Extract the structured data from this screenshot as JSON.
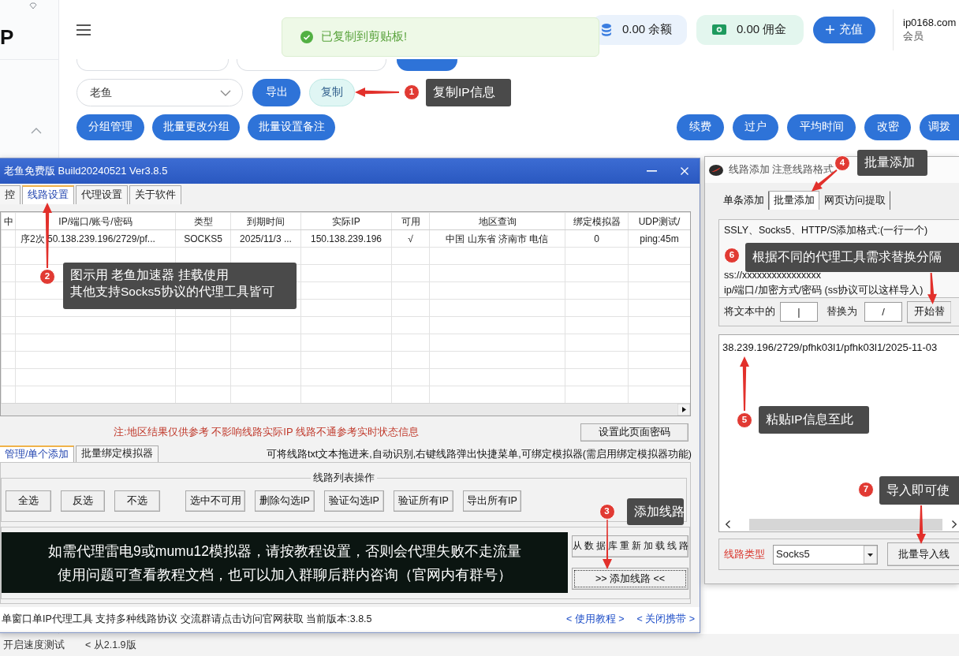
{
  "sidebar": {
    "logo": "P"
  },
  "header": {
    "toast": "已复制到剪贴板!",
    "balance": "0.00 余额",
    "commission": "0.00 佣金",
    "recharge_button": "充值",
    "account": {
      "name": "ip0168.com",
      "role": "会员"
    }
  },
  "filters": {
    "group_select": "老鱼",
    "export_button": "导出",
    "copy_button": "复制"
  },
  "actions_left": [
    "分组管理",
    "批量更改分组",
    "批量设置备注"
  ],
  "actions_right": [
    "续费",
    "过户",
    "平均时间",
    "改密",
    "调拨"
  ],
  "app_window": {
    "title": "老鱼免费版 Build20240521 Ver3.8.5",
    "tabs": [
      {
        "label": "控",
        "selected": false
      },
      {
        "label": "线路设置",
        "selected": true
      },
      {
        "label": "代理设置",
        "selected": false
      },
      {
        "label": "关于软件",
        "selected": false
      }
    ],
    "table": {
      "columns": [
        "中",
        "IP/端口/账号/密码",
        "类型",
        "到期时间",
        "实际IP",
        "可用",
        "地区查询",
        "绑定模拟器",
        "UDP测试/"
      ],
      "rows": [
        [
          "",
          "序2次 50.138.239.196/2729/pf...",
          "SOCKS5",
          "2025/11/3 ...",
          "150.138.239.196",
          "√",
          "中国 山东省 济南市 电信",
          "0",
          "ping:45m"
        ]
      ]
    },
    "note": "注:地区结果仅供参考 不影响线路实际IP 线路不通参考实时状态信息",
    "password_button": "设置此页面密码",
    "lower_tabs": [
      {
        "label": "管理/单个添加",
        "selected": true
      },
      {
        "label": "批量绑定模拟器",
        "selected": false
      }
    ],
    "hint": "可将线路txt文本拖进来,自动识别,右键线路弹出快捷菜单,可绑定模拟器(需启用绑定模拟器功能)",
    "list_actions": {
      "title": "线路列表操作",
      "buttons": [
        "全选",
        "反选",
        "不选",
        "选中不可用",
        "删除勾选IP",
        "验证勾选IP",
        "验证所有IP",
        "导出所有IP"
      ]
    },
    "banner": [
      "如需代理雷电9或mumu12模拟器，请按教程设置，否则会代理失败不走流量",
      "使用问题可查看教程文档，也可以加入群聊后群内咨询（官网内有群号）"
    ],
    "reload_button": "从数据库重新加载线路",
    "add_button": ">>  添加线路  <<",
    "status_bar": {
      "text": "单窗口单IP代理工具 支持多种线路协议 交流群请点击访问官网获取 当前版本:3.8.5",
      "links": [
        "< 使用教程 >",
        "< 关闭携带 >"
      ]
    }
  },
  "add_window": {
    "title": "线路添加 注意线路格式",
    "tabs": [
      {
        "label": "单条添加",
        "selected": false
      },
      {
        "label": "批量添加",
        "selected": true
      },
      {
        "label": "网页访问提取",
        "selected": false
      }
    ],
    "format_lines": [
      "SSLY、Socks5、HTTP/S添加格式:(一行一个)",
      "ss://xxxxxxxxxxxxxxxx",
      "ip/端口/加密方式/密码 (ss协议可以这样导入)"
    ],
    "replace": {
      "find_label": "将文本中的",
      "find_value": "|",
      "replace_label": "替换为",
      "replace_value": "/",
      "button": "开始替"
    },
    "paste_text": "38.239.196/2729/pfhk03l1/pfhk03l1/2025-11-03",
    "type_label": "线路类型",
    "type_select": "Socks5",
    "import_button": "批量导入线"
  },
  "callouts": [
    {
      "number": "1",
      "lines": [
        "复制IP信息"
      ]
    },
    {
      "number": "2",
      "lines": [
        "图示用 老鱼加速器 挂载使用",
        "其他支持Socks5协议的代理工具皆可"
      ]
    },
    {
      "number": "3",
      "lines": [
        "添加线路"
      ]
    },
    {
      "number": "4",
      "lines": [
        "批量添加"
      ]
    },
    {
      "number": "6",
      "lines": [
        "根据不同的代理工具需求替换分隔"
      ]
    },
    {
      "number": "5",
      "lines": [
        "粘贴IP信息至此"
      ]
    },
    {
      "number": "7",
      "lines": [
        "导入即可使"
      ]
    }
  ],
  "bottom_strip": [
    "开启速度测试",
    "< 从2.1.9版"
  ]
}
